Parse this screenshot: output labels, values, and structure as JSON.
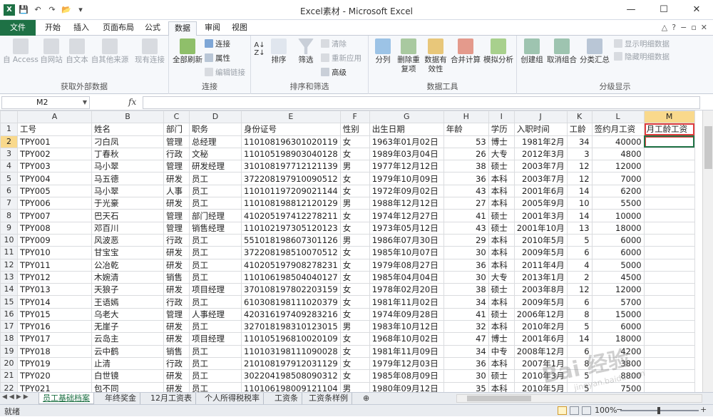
{
  "window": {
    "title": "Excel素材 - Microsoft Excel",
    "app_logo": "X",
    "controls": [
      "—",
      "☐",
      "✕"
    ]
  },
  "qat": [
    "💾",
    "↶",
    "↷",
    "📂",
    "▾"
  ],
  "tabs": [
    {
      "label": "文件"
    },
    {
      "label": "开始"
    },
    {
      "label": "插入"
    },
    {
      "label": "页面布局"
    },
    {
      "label": "公式"
    },
    {
      "label": "数据"
    },
    {
      "label": "审阅"
    },
    {
      "label": "视图"
    }
  ],
  "ribbon": {
    "groups": [
      {
        "label": "获取外部数据",
        "buttons": [
          "自 Access",
          "自网站",
          "自文本",
          "自其他来源",
          "现有连接"
        ]
      },
      {
        "label": "连接",
        "buttons": [
          "全部刷新",
          "连接",
          "属性",
          "编辑链接"
        ]
      },
      {
        "label": "排序和筛选",
        "buttons": [
          "排序",
          "筛选",
          "清除",
          "重新应用",
          "高级"
        ]
      },
      {
        "label": "数据工具",
        "buttons": [
          "分列",
          "删除重复项",
          "数据有效性",
          "合并计算",
          "模拟分析"
        ]
      },
      {
        "label": "分级显示",
        "buttons": [
          "创建组",
          "取消组合",
          "分类汇总",
          "显示明细数据",
          "隐藏明细数据"
        ]
      }
    ]
  },
  "formula_bar": {
    "name_box": "M2",
    "fx": "fx",
    "value": ""
  },
  "columns": [
    "A",
    "B",
    "C",
    "D",
    "E",
    "F",
    "G",
    "H",
    "I",
    "J",
    "K",
    "L",
    "M"
  ],
  "headers": [
    "工号",
    "姓名",
    "部门",
    "职务",
    "身份证号",
    "性别",
    "出生日期",
    "年龄",
    "学历",
    "入职时间",
    "工龄",
    "签约月工资",
    "月工龄工资"
  ],
  "rows": [
    [
      "TPY001",
      "刁白凤",
      "管理",
      "总经理",
      "110108196301020119",
      "女",
      "1963年01月02日",
      "53",
      "博士",
      "1981年2月",
      "34",
      "40000",
      ""
    ],
    [
      "TPY002",
      "丁春秋",
      "行政",
      "文秘",
      "110105198903040128",
      "女",
      "1989年03月04日",
      "26",
      "大专",
      "2012年3月",
      "3",
      "4800",
      ""
    ],
    [
      "TPY003",
      "马小翠",
      "管理",
      "研发经理",
      "310108197712121139",
      "男",
      "1977年12月12日",
      "38",
      "硕士",
      "2003年7月",
      "12",
      "12000",
      ""
    ],
    [
      "TPY004",
      "马五德",
      "研发",
      "员工",
      "372208197910090512",
      "女",
      "1979年10月09日",
      "36",
      "本科",
      "2003年7月",
      "12",
      "7000",
      ""
    ],
    [
      "TPY005",
      "马小翠",
      "人事",
      "员工",
      "110101197209021144",
      "女",
      "1972年09月02日",
      "43",
      "本科",
      "2001年6月",
      "14",
      "6200",
      ""
    ],
    [
      "TPY006",
      "于光豪",
      "研发",
      "员工",
      "110108198812120129",
      "男",
      "1988年12月12日",
      "27",
      "本科",
      "2005年9月",
      "10",
      "5500",
      ""
    ],
    [
      "TPY007",
      "巴天石",
      "管理",
      "部门经理",
      "410205197412278211",
      "女",
      "1974年12月27日",
      "41",
      "硕士",
      "2001年3月",
      "14",
      "10000",
      ""
    ],
    [
      "TPY008",
      "邓百川",
      "管理",
      "销售经理",
      "110102197305120123",
      "女",
      "1973年05月12日",
      "43",
      "硕士",
      "2001年10月",
      "13",
      "18000",
      ""
    ],
    [
      "TPY009",
      "风波恶",
      "行政",
      "员工",
      "551018198607301126",
      "男",
      "1986年07月30日",
      "29",
      "本科",
      "2010年5月",
      "5",
      "6000",
      ""
    ],
    [
      "TPY010",
      "甘宝宝",
      "研发",
      "员工",
      "372208198510070512",
      "女",
      "1985年10月07日",
      "30",
      "本科",
      "2009年5月",
      "6",
      "6000",
      ""
    ],
    [
      "TPY011",
      "公冶乾",
      "研发",
      "员工",
      "410205197908278231",
      "女",
      "1979年08月27日",
      "36",
      "本科",
      "2011年4月",
      "4",
      "5000",
      ""
    ],
    [
      "TPY012",
      "木婉清",
      "销售",
      "员工",
      "110106198504040127",
      "女",
      "1985年04月04日",
      "30",
      "大专",
      "2013年1月",
      "2",
      "4500",
      ""
    ],
    [
      "TPY013",
      "天狼子",
      "研发",
      "项目经理",
      "370108197802203159",
      "女",
      "1978年02月20日",
      "38",
      "硕士",
      "2003年8月",
      "12",
      "12000",
      ""
    ],
    [
      "TPY014",
      "王语嫣",
      "行政",
      "员工",
      "610308198111020379",
      "女",
      "1981年11月02日",
      "34",
      "本科",
      "2009年5月",
      "6",
      "5700",
      ""
    ],
    [
      "TPY015",
      "乌老大",
      "管理",
      "人事经理",
      "420316197409283216",
      "女",
      "1974年09月28日",
      "41",
      "硕士",
      "2006年12月",
      "8",
      "15000",
      ""
    ],
    [
      "TPY016",
      "无崖子",
      "研发",
      "员工",
      "327018198310123015",
      "男",
      "1983年10月12日",
      "32",
      "本科",
      "2010年2月",
      "5",
      "6000",
      ""
    ],
    [
      "TPY017",
      "云岛主",
      "研发",
      "项目经理",
      "110105196810020109",
      "女",
      "1968年10月02日",
      "47",
      "博士",
      "2001年6月",
      "14",
      "18000",
      ""
    ],
    [
      "TPY018",
      "云中鹤",
      "销售",
      "员工",
      "110103198111090028",
      "女",
      "1981年11月09日",
      "34",
      "中专",
      "2008年12月",
      "6",
      "4200",
      ""
    ],
    [
      "TPY019",
      "止清",
      "行政",
      "员工",
      "210108197912031129",
      "女",
      "1979年12月03日",
      "36",
      "本科",
      "2007年1月",
      "8",
      "3800",
      ""
    ],
    [
      "TPY020",
      "白世镜",
      "研发",
      "员工",
      "302204198508090312",
      "女",
      "1985年08月09日",
      "30",
      "硕士",
      "2010年3月",
      "5",
      "8800",
      ""
    ],
    [
      "TPY021",
      "包不同",
      "研发",
      "员工",
      "110106198009121104",
      "男",
      "1980年09月12日",
      "35",
      "本科",
      "2010年5月",
      "5",
      "7500",
      ""
    ]
  ],
  "sheet_tabs": [
    "员工基础档案",
    "年终奖金",
    "12月工资表",
    "个人所得税税率",
    "工资条",
    "工资条样例"
  ],
  "status": {
    "ready": "就绪",
    "zoom": "100%"
  },
  "watermark": {
    "main": "Bai 经验",
    "sub": "jingyan.baidu.com"
  }
}
